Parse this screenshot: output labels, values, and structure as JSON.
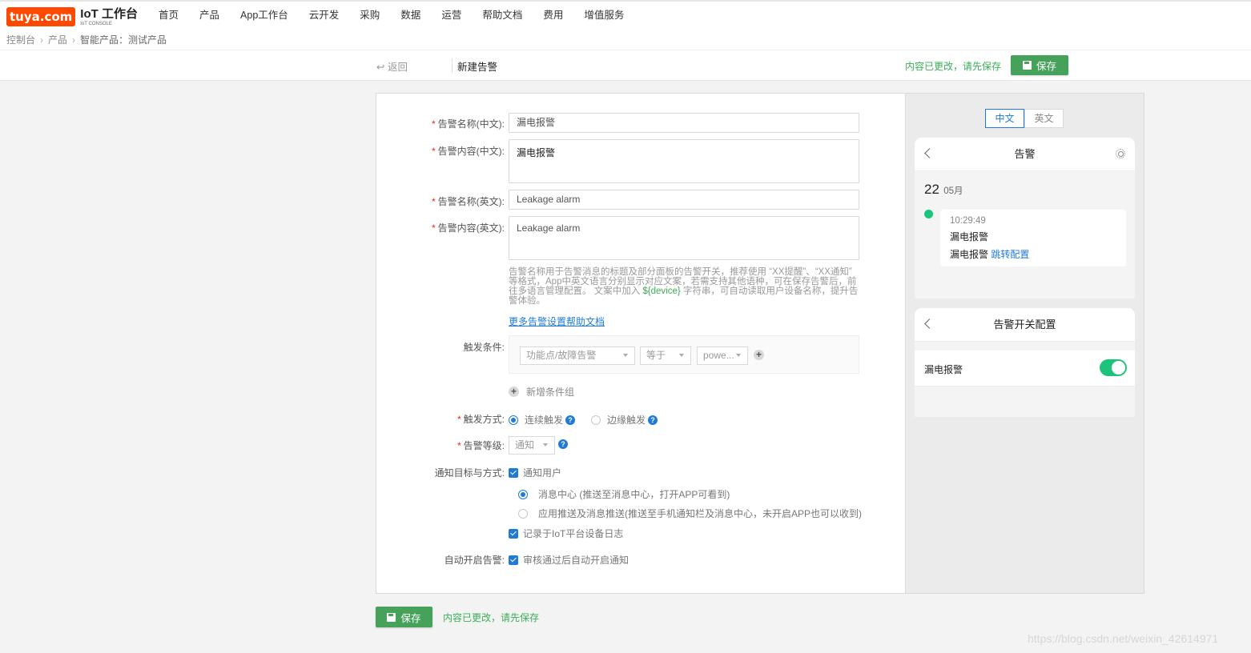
{
  "brand": {
    "logo": "tuya.com",
    "title": "IoT 工作台",
    "subtitle": "IoT CONSOLE"
  },
  "nav": [
    "首页",
    "产品",
    "App工作台",
    "云开发",
    "采购",
    "数据",
    "运营",
    "帮助文档",
    "费用",
    "增值服务"
  ],
  "breadcrumb": {
    "items": [
      "控制台",
      "产品"
    ],
    "current": "智能产品：测试产品"
  },
  "subbar": {
    "back": "返回",
    "title": "新建告警",
    "unsaved": "内容已更改，请先保存",
    "save": "保存"
  },
  "form": {
    "name_cn_label": "告警名称(中文):",
    "name_cn_value": "漏电报警",
    "content_cn_label": "告警内容(中文):",
    "content_cn_value": "漏电报警",
    "name_en_label": "告警名称(英文):",
    "name_en_value": "Leakage alarm",
    "content_en_label": "告警内容(英文):",
    "content_en_value": "Leakage alarm",
    "hint_before": "告警名称用于告警消息的标题及部分面板的告警开关，推荐使用 “XX提醒”、“XX通知” 等格式，App中英文语言分别显示对应文案，若需支持其他语种，可在保存告警后，前往多语言管理配置。 文案中加入 ",
    "hint_var": "${device}",
    "hint_after": " 字符串，可自动读取用户设备名称，提升告警体验。",
    "help_link": "更多告警设置帮助文档",
    "trigger_label": "触发条件:",
    "trigger_dp": "功能点/故障告警",
    "trigger_op": "等于",
    "trigger_val": "powe...",
    "add_group": "新增条件组",
    "mode_label": "触发方式:",
    "mode_continuous": "连续触发",
    "mode_edge": "边缘触发",
    "level_label": "告警等级:",
    "level_value": "通知",
    "notify_label": "通知目标与方式:",
    "notify_users": "通知用户",
    "msg_center": "消息中心 (推送至消息中心，打开APP可看到)",
    "push_center": "应用推送及消息推送(推送至手机通知栏及消息中心，未开启APP也可以收到)",
    "log_record": "记录于IoT平台设备日志",
    "auto_label": "自动开启告警:",
    "auto_value": "审核通过后自动开启通知"
  },
  "preview": {
    "lang_cn": "中文",
    "lang_en": "英文",
    "phone_title": "告警",
    "day": "22",
    "month": "05月",
    "time": "10:29:49",
    "msg_title": "漏电报警",
    "msg_body": "漏电报警",
    "msg_link": "跳转配置",
    "switch_title": "告警开关配置",
    "switch_item": "漏电报警",
    "switch_on": true
  },
  "footer": {
    "save": "保存",
    "unsaved": "内容已更改，请先保存"
  },
  "watermark": "https://blog.csdn.net/weixin_42614971",
  "colors": {
    "accent": "#46a15b",
    "link": "#1f7bd6",
    "brand": "#ff4800",
    "toggle": "#1cc47b"
  }
}
